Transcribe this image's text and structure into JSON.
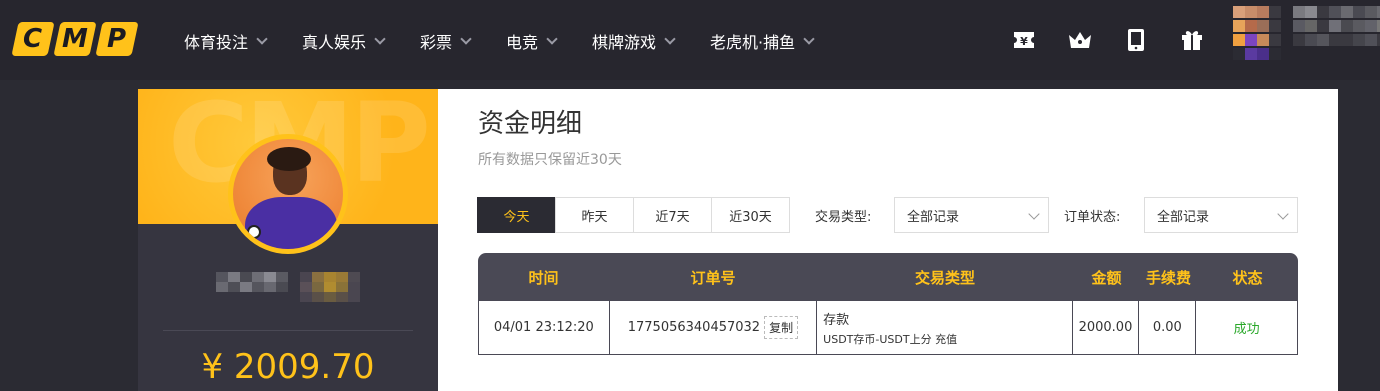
{
  "logo": {
    "letters": [
      "C",
      "M",
      "P"
    ]
  },
  "nav": {
    "items": [
      {
        "label": "体育投注"
      },
      {
        "label": "真人娱乐"
      },
      {
        "label": "彩票"
      },
      {
        "label": "电竞"
      },
      {
        "label": "棋牌游戏"
      },
      {
        "label": "老虎机·捕鱼"
      }
    ],
    "icons": [
      "yen-icon",
      "crown-icon",
      "tablet-icon",
      "gift-icon"
    ]
  },
  "sidebar": {
    "balance": "¥ 2009.70",
    "banner_watermark": "CMP"
  },
  "main": {
    "title": "资金明细",
    "subtitle": "所有数据只保留近30天",
    "tabs": [
      {
        "label": "今天",
        "active": true
      },
      {
        "label": "昨天",
        "active": false
      },
      {
        "label": "近7天",
        "active": false
      },
      {
        "label": "近30天",
        "active": false
      }
    ],
    "filters": {
      "type_label": "交易类型:",
      "type_value": "全部记录",
      "status_label": "订单状态:",
      "status_value": "全部记录"
    },
    "table": {
      "headers": [
        "时间",
        "订单号",
        "交易类型",
        "金额",
        "手续费",
        "状态"
      ],
      "rows": [
        {
          "time": "04/01 23:12:20",
          "order_no": "1775056340457032",
          "copy_label": "复制",
          "type_main": "存款",
          "type_detail": "USDT存币-USDT上分 充值",
          "amount": "2000.00",
          "fee": "0.00",
          "status": "成功"
        }
      ]
    }
  },
  "colors": {
    "accent": "#ffc21a",
    "dark": "#2b2b33",
    "success": "#2aa82a"
  }
}
